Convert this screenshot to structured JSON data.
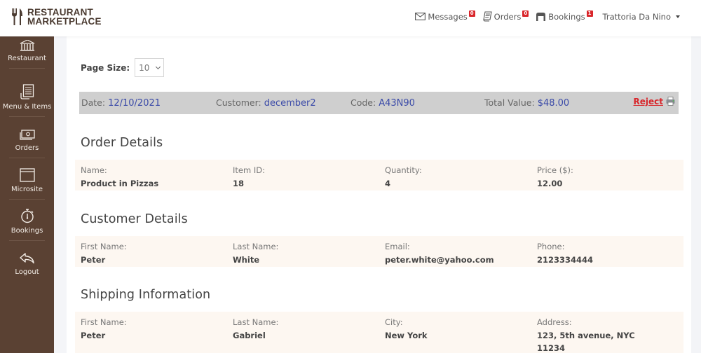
{
  "header": {
    "logo_line1": "RESTAURANT",
    "logo_line2": "MARKETPLACE",
    "nav": [
      {
        "icon": "envelope-icon",
        "label": "Messages",
        "badge": "0"
      },
      {
        "icon": "receipt-icon",
        "label": "Orders",
        "badge": "0"
      },
      {
        "icon": "table-icon",
        "label": "Bookings",
        "badge": "1"
      }
    ],
    "user_name": "Trattoria Da Nino"
  },
  "sidebar": {
    "items": [
      {
        "icon": "building-icon",
        "label": "Restaurant"
      },
      {
        "icon": "menu-icon",
        "label": "Menu & Items"
      },
      {
        "icon": "cash-icon",
        "label": "Orders"
      },
      {
        "icon": "browser-window-icon",
        "label": "Microsite"
      },
      {
        "icon": "stopwatch-icon",
        "label": "Bookings"
      },
      {
        "icon": "reply-arrow-icon",
        "label": "Logout"
      }
    ]
  },
  "controls": {
    "page_size_label": "Page Size:",
    "page_size_value": "10"
  },
  "order": {
    "date_label": "Date:",
    "date_value": "12/10/2021",
    "customer_label": "Customer:",
    "customer_value": "december2",
    "code_label": "Code:",
    "code_value": "A43N90",
    "total_label": "Total Value:",
    "total_value": "$48.00",
    "reject_label": "Reject"
  },
  "sections": {
    "order_details": {
      "title": "Order Details",
      "fields": [
        {
          "label": "Name:",
          "value": "Product in Pizzas"
        },
        {
          "label": "Item ID:",
          "value": "18"
        },
        {
          "label": "Quantity:",
          "value": "4"
        },
        {
          "label": "Price ($):",
          "value": "12.00"
        }
      ]
    },
    "customer_details": {
      "title": "Customer Details",
      "fields": [
        {
          "label": "First Name:",
          "value": "Peter"
        },
        {
          "label": "Last Name:",
          "value": "White"
        },
        {
          "label": "Email:",
          "value": "peter.white@yahoo.com"
        },
        {
          "label": "Phone:",
          "value": "2123334444"
        }
      ]
    },
    "shipping_information": {
      "title": "Shipping Information",
      "fields": [
        {
          "label": "First Name:",
          "value": "Peter"
        },
        {
          "label": "Last Name:",
          "value": "Gabriel"
        },
        {
          "label": "City:",
          "value": "New York"
        },
        {
          "label": "Address:",
          "value": "123, 5th avenue, NYC",
          "value2": "11234"
        }
      ]
    }
  },
  "colors": {
    "sidebar_bg": "#5a4133",
    "accent_blue": "#3a4aa8",
    "reject_red": "#d8262b",
    "badge_red": "#d9262b",
    "panel_bg": "#fdf7f1",
    "order_bar_bg": "#cfcfcf"
  }
}
